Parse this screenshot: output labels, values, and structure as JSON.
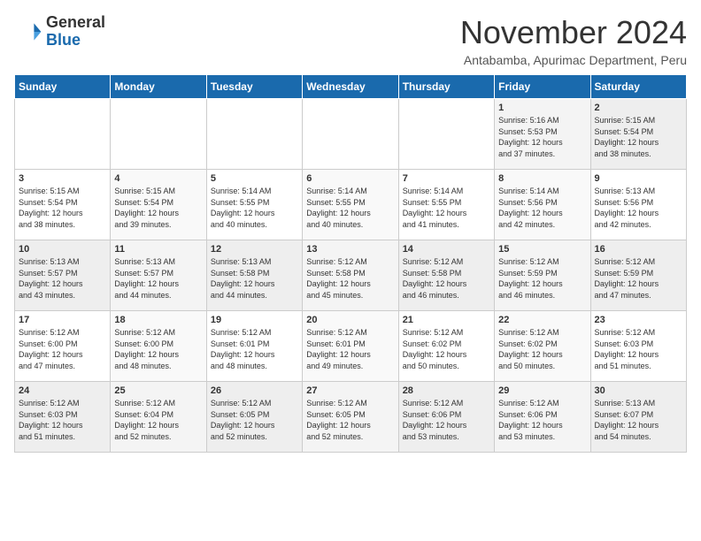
{
  "logo": {
    "general": "General",
    "blue": "Blue"
  },
  "title": {
    "month": "November 2024",
    "location": "Antabamba, Apurimac Department, Peru"
  },
  "days_header": [
    "Sunday",
    "Monday",
    "Tuesday",
    "Wednesday",
    "Thursday",
    "Friday",
    "Saturday"
  ],
  "weeks": [
    [
      {
        "day": "",
        "info": ""
      },
      {
        "day": "",
        "info": ""
      },
      {
        "day": "",
        "info": ""
      },
      {
        "day": "",
        "info": ""
      },
      {
        "day": "",
        "info": ""
      },
      {
        "day": "1",
        "info": "Sunrise: 5:16 AM\nSunset: 5:53 PM\nDaylight: 12 hours\nand 37 minutes."
      },
      {
        "day": "2",
        "info": "Sunrise: 5:15 AM\nSunset: 5:54 PM\nDaylight: 12 hours\nand 38 minutes."
      }
    ],
    [
      {
        "day": "3",
        "info": "Sunrise: 5:15 AM\nSunset: 5:54 PM\nDaylight: 12 hours\nand 38 minutes."
      },
      {
        "day": "4",
        "info": "Sunrise: 5:15 AM\nSunset: 5:54 PM\nDaylight: 12 hours\nand 39 minutes."
      },
      {
        "day": "5",
        "info": "Sunrise: 5:14 AM\nSunset: 5:55 PM\nDaylight: 12 hours\nand 40 minutes."
      },
      {
        "day": "6",
        "info": "Sunrise: 5:14 AM\nSunset: 5:55 PM\nDaylight: 12 hours\nand 40 minutes."
      },
      {
        "day": "7",
        "info": "Sunrise: 5:14 AM\nSunset: 5:55 PM\nDaylight: 12 hours\nand 41 minutes."
      },
      {
        "day": "8",
        "info": "Sunrise: 5:14 AM\nSunset: 5:56 PM\nDaylight: 12 hours\nand 42 minutes."
      },
      {
        "day": "9",
        "info": "Sunrise: 5:13 AM\nSunset: 5:56 PM\nDaylight: 12 hours\nand 42 minutes."
      }
    ],
    [
      {
        "day": "10",
        "info": "Sunrise: 5:13 AM\nSunset: 5:57 PM\nDaylight: 12 hours\nand 43 minutes."
      },
      {
        "day": "11",
        "info": "Sunrise: 5:13 AM\nSunset: 5:57 PM\nDaylight: 12 hours\nand 44 minutes."
      },
      {
        "day": "12",
        "info": "Sunrise: 5:13 AM\nSunset: 5:58 PM\nDaylight: 12 hours\nand 44 minutes."
      },
      {
        "day": "13",
        "info": "Sunrise: 5:12 AM\nSunset: 5:58 PM\nDaylight: 12 hours\nand 45 minutes."
      },
      {
        "day": "14",
        "info": "Sunrise: 5:12 AM\nSunset: 5:58 PM\nDaylight: 12 hours\nand 46 minutes."
      },
      {
        "day": "15",
        "info": "Sunrise: 5:12 AM\nSunset: 5:59 PM\nDaylight: 12 hours\nand 46 minutes."
      },
      {
        "day": "16",
        "info": "Sunrise: 5:12 AM\nSunset: 5:59 PM\nDaylight: 12 hours\nand 47 minutes."
      }
    ],
    [
      {
        "day": "17",
        "info": "Sunrise: 5:12 AM\nSunset: 6:00 PM\nDaylight: 12 hours\nand 47 minutes."
      },
      {
        "day": "18",
        "info": "Sunrise: 5:12 AM\nSunset: 6:00 PM\nDaylight: 12 hours\nand 48 minutes."
      },
      {
        "day": "19",
        "info": "Sunrise: 5:12 AM\nSunset: 6:01 PM\nDaylight: 12 hours\nand 48 minutes."
      },
      {
        "day": "20",
        "info": "Sunrise: 5:12 AM\nSunset: 6:01 PM\nDaylight: 12 hours\nand 49 minutes."
      },
      {
        "day": "21",
        "info": "Sunrise: 5:12 AM\nSunset: 6:02 PM\nDaylight: 12 hours\nand 50 minutes."
      },
      {
        "day": "22",
        "info": "Sunrise: 5:12 AM\nSunset: 6:02 PM\nDaylight: 12 hours\nand 50 minutes."
      },
      {
        "day": "23",
        "info": "Sunrise: 5:12 AM\nSunset: 6:03 PM\nDaylight: 12 hours\nand 51 minutes."
      }
    ],
    [
      {
        "day": "24",
        "info": "Sunrise: 5:12 AM\nSunset: 6:03 PM\nDaylight: 12 hours\nand 51 minutes."
      },
      {
        "day": "25",
        "info": "Sunrise: 5:12 AM\nSunset: 6:04 PM\nDaylight: 12 hours\nand 52 minutes."
      },
      {
        "day": "26",
        "info": "Sunrise: 5:12 AM\nSunset: 6:05 PM\nDaylight: 12 hours\nand 52 minutes."
      },
      {
        "day": "27",
        "info": "Sunrise: 5:12 AM\nSunset: 6:05 PM\nDaylight: 12 hours\nand 52 minutes."
      },
      {
        "day": "28",
        "info": "Sunrise: 5:12 AM\nSunset: 6:06 PM\nDaylight: 12 hours\nand 53 minutes."
      },
      {
        "day": "29",
        "info": "Sunrise: 5:12 AM\nSunset: 6:06 PM\nDaylight: 12 hours\nand 53 minutes."
      },
      {
        "day": "30",
        "info": "Sunrise: 5:13 AM\nSunset: 6:07 PM\nDaylight: 12 hours\nand 54 minutes."
      }
    ]
  ]
}
